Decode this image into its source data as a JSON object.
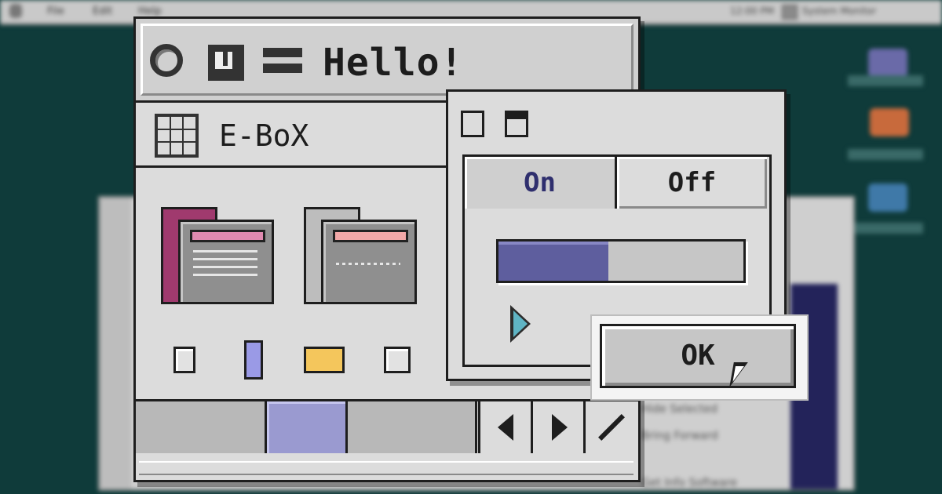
{
  "desktop": {
    "menubar": {
      "items": [
        "File",
        "Edit",
        "Help"
      ],
      "clock": "12:00 PM",
      "app_name": "System Monitor"
    },
    "bg_window_rows": [
      "Hide Selected",
      "Bring Forward",
      "Get Info Software"
    ]
  },
  "main_window": {
    "title": "Hello!",
    "icons": [
      "ring-icon",
      "note-icon",
      "menu-icon"
    ],
    "subwindow_title": "E-BoX",
    "folders": [
      {
        "name": "folder-magenta",
        "accent": "#a03a6e",
        "tab": "#e08ab0"
      },
      {
        "name": "folder-gray",
        "accent": "#bdbdbd",
        "tab": "#f2a8a8"
      }
    ],
    "small_controls": [
      "checkbox",
      "slider-thumb",
      "yellow-button",
      "checkbox"
    ],
    "segments": [
      "segment-1",
      "segment-2",
      "segment-3"
    ],
    "nav": [
      "left-arrow",
      "right-arrow",
      "pencil"
    ]
  },
  "second_window": {
    "toggle_on": "On",
    "toggle_off": "Off",
    "progress": 0.45
  },
  "dialog": {
    "ok_label": "OK"
  },
  "colors": {
    "teal_bg": "#0f3b3a",
    "window_gray": "#dcdcdc",
    "accent_blue": "#5e5e9e",
    "segment_blue": "#9a9ad0",
    "play_teal": "#5fb4c4",
    "yellow": "#f4c65c"
  }
}
